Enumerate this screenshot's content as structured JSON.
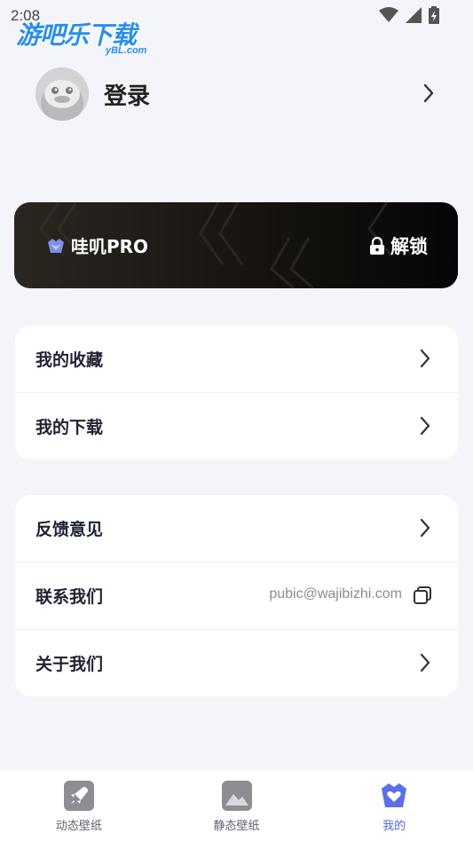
{
  "status_bar": {
    "time": "2:08"
  },
  "watermark": {
    "title": "游吧乐下载",
    "subtitle": "yBL.com"
  },
  "profile": {
    "login_label": "登录"
  },
  "pro_card": {
    "title": "哇叽PRO",
    "unlock_label": "解锁"
  },
  "menu_group_1": [
    {
      "label": "我的收藏"
    },
    {
      "label": "我的下载"
    }
  ],
  "menu_group_2": {
    "feedback": "反馈意见",
    "contact": "联系我们",
    "contact_email": "pubic@wajibizhi.com",
    "about": "关于我们"
  },
  "tabbar": {
    "items": [
      {
        "label": "动态壁纸",
        "icon": "rocket-icon"
      },
      {
        "label": "静态壁纸",
        "icon": "image-icon"
      },
      {
        "label": "我的",
        "icon": "heart-shield-icon"
      }
    ],
    "active_index": 2
  },
  "colors": {
    "accent": "#5566dd",
    "background": "#f4f5fa",
    "card_dark": "#17140f"
  }
}
